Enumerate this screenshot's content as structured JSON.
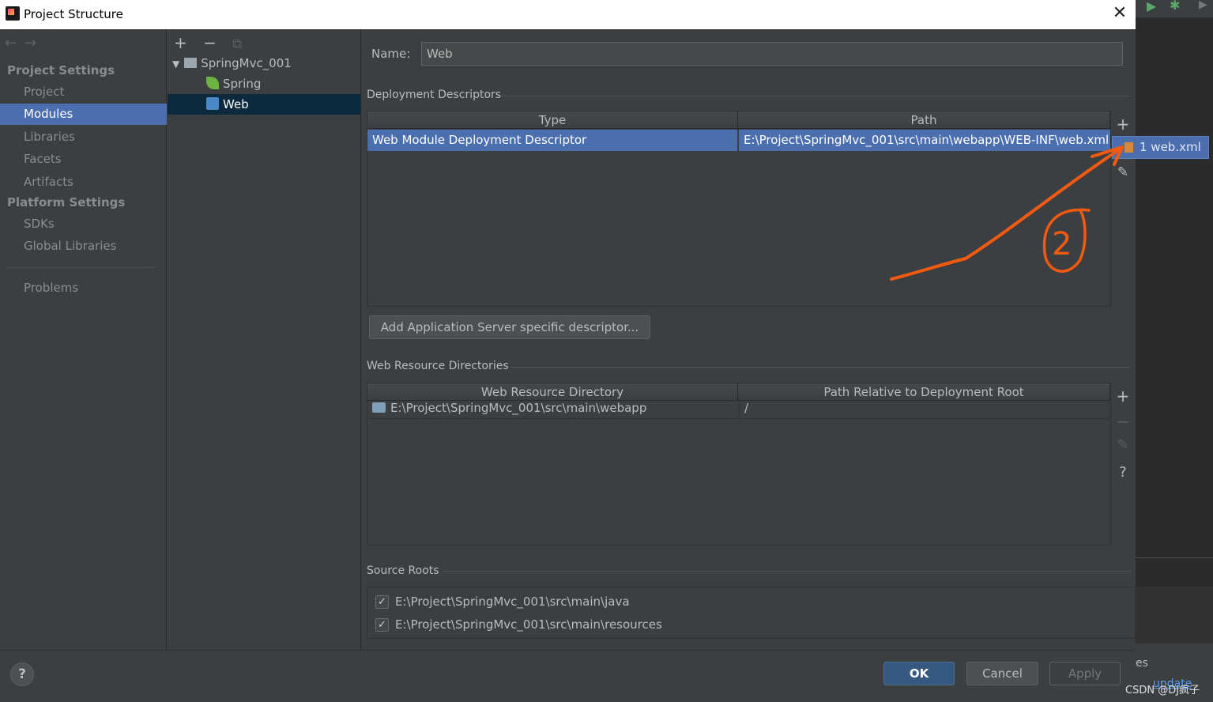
{
  "window": {
    "title": "Project Structure"
  },
  "sidebar": {
    "project_settings": "Project Settings",
    "items": [
      "Project",
      "Modules",
      "Libraries",
      "Facets",
      "Artifacts"
    ],
    "platform_settings": "Platform Settings",
    "platform_items": [
      "SDKs",
      "Global Libraries"
    ],
    "problems": "Problems"
  },
  "tree": {
    "root": "SpringMvc_001",
    "children": [
      "Spring",
      "Web"
    ]
  },
  "main": {
    "name_label": "Name:",
    "name_value": "Web",
    "deployment": {
      "title": "Deployment Descriptors",
      "headers": [
        "Type",
        "Path"
      ],
      "row": {
        "type": "Web Module Deployment Descriptor",
        "path": "E:\\Project\\SpringMvc_001\\src\\main\\webapp\\WEB-INF\\web.xml"
      },
      "add_button": "Add Application Server specific descriptor..."
    },
    "web_resources": {
      "title": "Web Resource Directories",
      "headers": [
        "Web Resource Directory",
        "Path Relative to Deployment Root"
      ],
      "row": {
        "directory": "E:\\Project\\SpringMvc_001\\src\\main\\webapp",
        "relative": "/"
      }
    },
    "source_roots": {
      "title": "Source Roots",
      "items": [
        "E:\\Project\\SpringMvc_001\\src\\main\\java",
        "E:\\Project\\SpringMvc_001\\src\\main\\resources"
      ]
    }
  },
  "popup": {
    "item": "1  web.xml"
  },
  "buttons": {
    "ok": "OK",
    "cancel": "Cancel",
    "apply": "Apply",
    "help": "?"
  },
  "background": {
    "fragment1": "es",
    "fragment2": "update"
  },
  "watermark": "CSDN @DJ疯子",
  "annotation": {
    "label": "2",
    "color": "#f25a10"
  }
}
